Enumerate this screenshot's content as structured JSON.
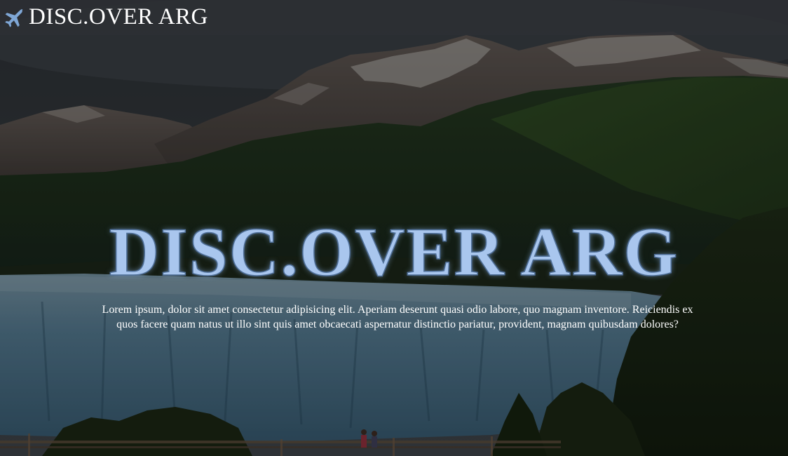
{
  "header": {
    "brand_icon": "airplane-icon",
    "brand_name": "DISC.OVER ARG"
  },
  "hero": {
    "title": "DISC.OVER ARG",
    "description": "Lorem ipsum, dolor sit amet consectetur adipisicing elit. Aperiam deserunt quasi odio labore, quo magnam inventore. Reiciendis ex quos facere quam natus ut illo sint quis amet obcaecati aspernatur distinctio pariatur, provident, magnam quibusdam dolores?",
    "background_image": "mountains-glacier-forest-landscape"
  },
  "colors": {
    "title_fill": "#a9c6ee",
    "topbar": "#2d3034",
    "text": "#ffffff"
  }
}
